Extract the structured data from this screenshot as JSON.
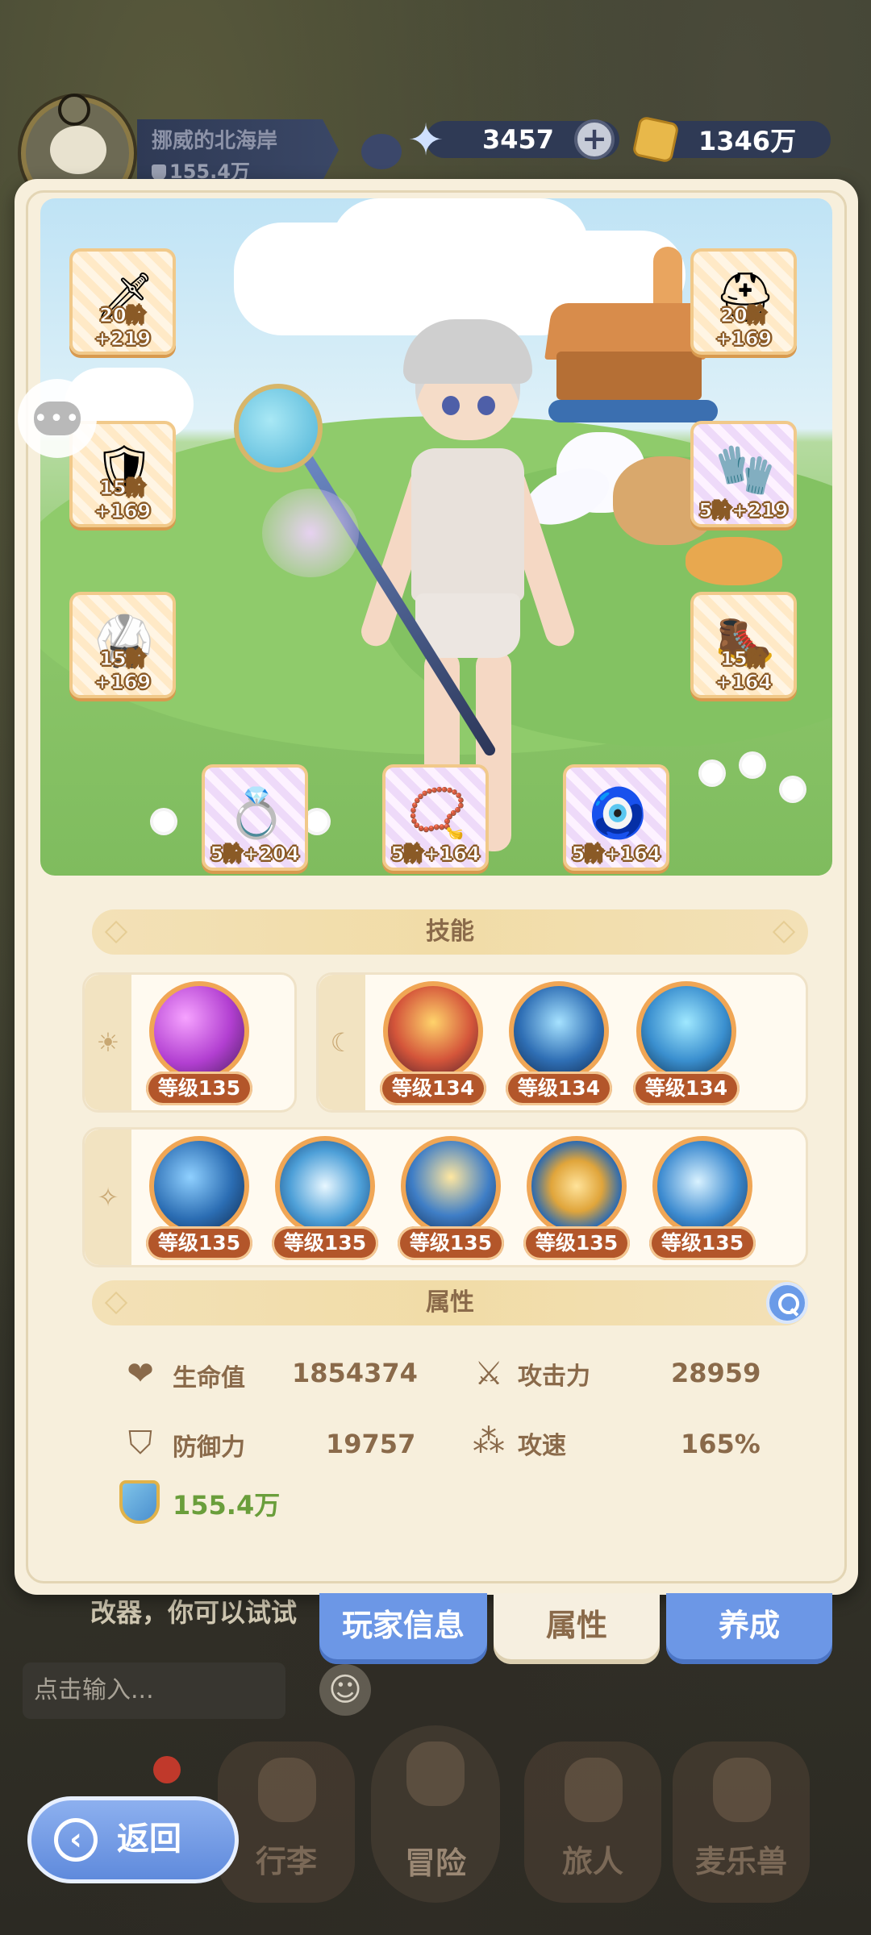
{
  "hud": {
    "player_name": "挪威的北海岸",
    "player_power": "155.4万",
    "gems": "3457",
    "plus_label": "+",
    "coins": "1346万"
  },
  "equipment": {
    "left": [
      {
        "level": "20阶+219",
        "icon": "golden-spear-icon"
      },
      {
        "level": "15阶+169",
        "icon": "red-armor-icon"
      },
      {
        "level": "15阶+169",
        "icon": "blue-chestplate-icon"
      }
    ],
    "right": [
      {
        "level": "20阶+169",
        "icon": "red-helmet-icon"
      },
      {
        "level": "5阶+219",
        "icon": "red-gauntlet-icon"
      },
      {
        "level": "15阶+164",
        "icon": "boots-icon"
      }
    ],
    "bottom": [
      {
        "level": "5阶+204",
        "icon": "star-ring-icon"
      },
      {
        "level": "5阶+164",
        "icon": "red-necklace-icon"
      },
      {
        "level": "5阶+164",
        "icon": "amulet-icon"
      }
    ]
  },
  "chat_icon_text": "•••",
  "skills": {
    "title": "技能",
    "sun_icon": "☀",
    "moon_icon": "☾",
    "star_icon": "✧",
    "sun": [
      {
        "label": "等级135",
        "color": "#b23fd1"
      }
    ],
    "moon": [
      {
        "label": "等级134",
        "color": "#d4553a"
      },
      {
        "label": "等级134",
        "color": "#2f6fb5"
      },
      {
        "label": "等级134",
        "color": "#3a8fcf"
      }
    ],
    "star": [
      {
        "label": "等级135",
        "color": "#2b6db3"
      },
      {
        "label": "等级135",
        "color": "#4ea0d8"
      },
      {
        "label": "等级135",
        "color": "#3f7ec6"
      },
      {
        "label": "等级135",
        "color": "#e0a53b"
      },
      {
        "label": "等级135",
        "color": "#3d8bd0"
      }
    ]
  },
  "attributes": {
    "title": "属性",
    "hp_label": "生命值",
    "hp_value": "1854374",
    "atk_label": "攻击力",
    "atk_value": "28959",
    "def_label": "防御力",
    "def_value": "19757",
    "spd_label": "攻速",
    "spd_value": "165%",
    "power_value": "155.4万"
  },
  "panel_tabs": {
    "player_info": "玩家信息",
    "attributes": "属性",
    "cultivate": "养成"
  },
  "background": {
    "chat_hint": "改器，你可以试试",
    "chat_placeholder": "点击输入..."
  },
  "bottom_nav": {
    "back": "返回",
    "luggage": "行李",
    "adventure": "冒险",
    "traveler": "旅人",
    "pet": "麦乐兽"
  }
}
